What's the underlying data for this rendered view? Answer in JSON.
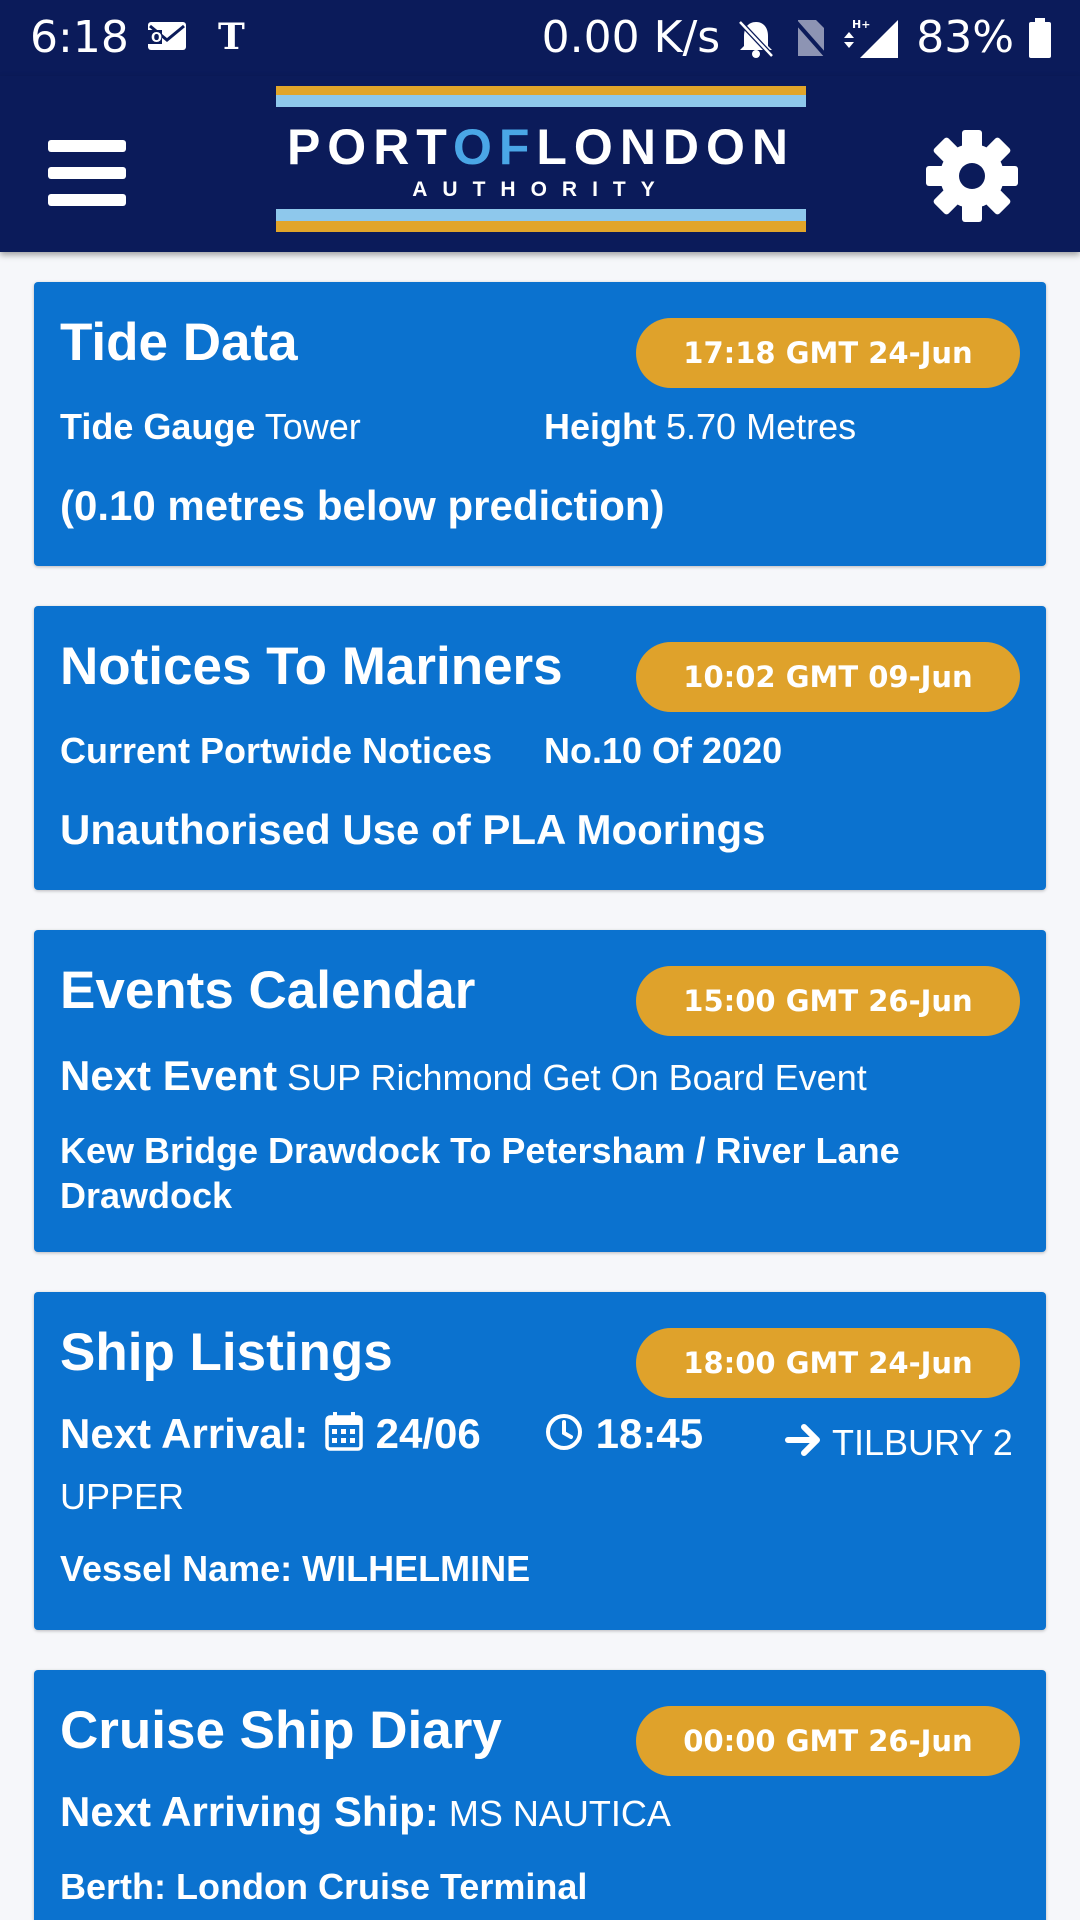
{
  "status_bar": {
    "time": "6:18",
    "network_speed": "0.00 K/s",
    "battery": "83%"
  },
  "app_bar": {
    "logo_main_a": "PORT",
    "logo_main_of": "OF",
    "logo_main_b": "LONDON",
    "logo_sub": "AUTHORITY"
  },
  "tide": {
    "title": "Tide Data",
    "badge": "17:18 GMT 24-Jun",
    "gauge_label": "Tide Gauge",
    "gauge_value": "Tower",
    "height_label": "Height",
    "height_value": "5.70 Metres",
    "note": "(0.10 metres below prediction)"
  },
  "notices": {
    "title": "Notices To Mariners",
    "badge": "10:02 GMT 09-Jun",
    "current_label": "Current Portwide Notices",
    "number": "No.10 Of 2020",
    "headline": "Unauthorised Use of PLA Moorings"
  },
  "events": {
    "title": "Events Calendar",
    "badge": "15:00 GMT 26-Jun",
    "next_label": "Next Event",
    "next_value": "SUP Richmond Get On Board Event",
    "location": "Kew Bridge Drawdock To Petersham / River Lane Drawdock"
  },
  "ships": {
    "title": "Ship Listings",
    "badge": "18:00 GMT 24-Jun",
    "arrival_label": "Next Arrival:",
    "date": "24/06",
    "time": "18:45",
    "destination": "TILBURY 2 UPPER",
    "vessel": "Vessel Name: WILHELMINE"
  },
  "cruise": {
    "title": "Cruise Ship Diary",
    "badge": "00:00 GMT 26-Jun",
    "ship_label": "Next Arriving Ship:",
    "ship_value": "MS NAUTICA",
    "berth": "Berth: London Cruise Terminal"
  }
}
